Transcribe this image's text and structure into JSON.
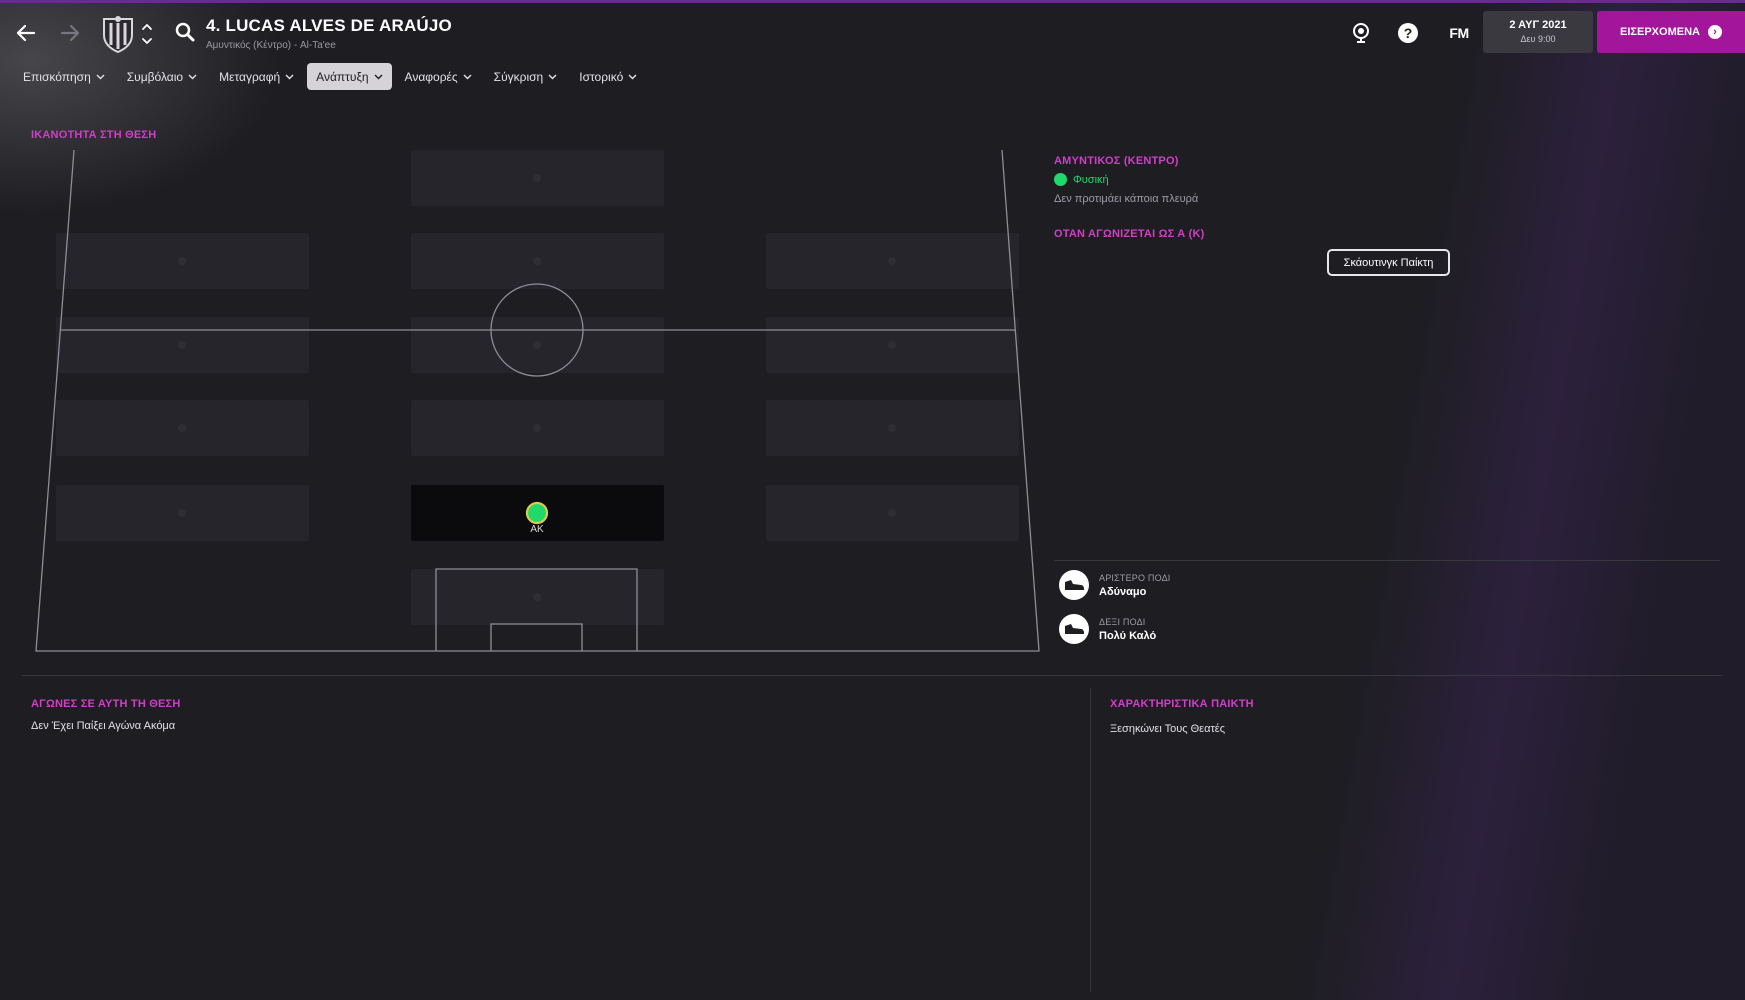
{
  "header": {
    "player_name": "4. LUCAS ALVES DE ARAÚJO",
    "player_subtitle": "Αμυντικός (Κέντρο) - Al-Ta'ee",
    "date_main": "2 ΑΥΓ 2021",
    "date_sub": "Δευ 9:00",
    "fm_logo": "FM",
    "continue_label": "ΕΙΣΕΡΧΟΜΕΝΑ",
    "help_glyph": "?"
  },
  "tabs": [
    {
      "label": "Επισκόπηση"
    },
    {
      "label": "Συμβόλαιο"
    },
    {
      "label": "Μεταγραφή"
    },
    {
      "label": "Ανάπτυξη",
      "active": true
    },
    {
      "label": "Αναφορές"
    },
    {
      "label": "Σύγκριση"
    },
    {
      "label": "Ιστορικό"
    }
  ],
  "position_ability": {
    "title": "ΙΚΑΝΟΤΗΤΑ ΣΤΗ ΘΕΣΗ",
    "player_position_label": "ΑΚ"
  },
  "position_info": {
    "position_title": "ΑΜΥΝΤΙΚΟΣ (ΚΕΝΤΡΟ)",
    "natural_label": "Φυσική",
    "side_text": "Δεν προτιμάει κάποια πλευρά",
    "when_playing_title": "ΟΤΑΝ ΑΓΩΝΙΖΕΤΑΙ ΩΣ Α (Κ)",
    "scout_button": "Σκάουτινγκ Παίκτη"
  },
  "feet": {
    "left_caption": "ΑΡΙΣΤΕΡΟ ΠΟΔΙ",
    "left_value": "Αδύναμο",
    "right_caption": "ΔΕΞΙ ΠΟΔΙ",
    "right_value": "Πολύ Καλό"
  },
  "matches": {
    "title": "ΑΓΩΝΕΣ ΣΕ ΑΥΤΗ ΤΗ ΘΕΣΗ",
    "text": "Δεν Έχει Παίξει Αγώνα Ακόμα"
  },
  "traits": {
    "title": "ΧΑΡΑΚΤΗΡΙΣΤΙΚΑ ΠΑΙΚΤΗ",
    "items": [
      "Ξεσηκώνει Τους Θεατές"
    ]
  },
  "colors": {
    "accent": "#d23ec8",
    "continue_bg": "#a3159a",
    "natural_green": "#1fd96a"
  }
}
